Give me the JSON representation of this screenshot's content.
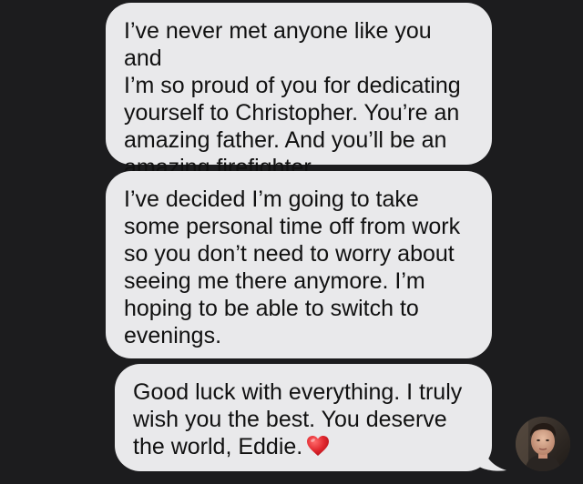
{
  "conversation": {
    "messages": [
      {
        "sender": "other",
        "text": "I’ve never met anyone like you and\nI’m so proud of you for dedicating\nyourself to Christopher. You’re an\namazing father. And you’ll be an\namazing firefighter."
      },
      {
        "sender": "other",
        "text": "I’ve decided I’m going to take\nsome personal time off from work\nso you don’t need to worry about\nseeing me there anymore. I’m\nhoping to be able to switch to\nevenings."
      },
      {
        "sender": "other",
        "text": "Good luck with everything. I truly\nwish you the best. You deserve\nthe world, Eddie.",
        "emoji": "red-heart"
      }
    ],
    "avatar_icon": "contact-photo"
  },
  "colors": {
    "background": "#1c1c1e",
    "bubble_received": "#e9e9eb",
    "text": "#111111",
    "heart": "#e0262d"
  }
}
